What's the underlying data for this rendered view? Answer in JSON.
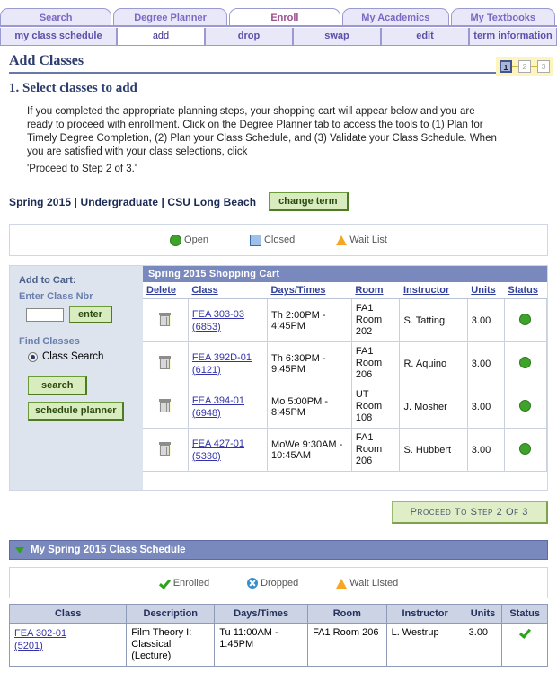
{
  "main_tabs": [
    {
      "label": "Search",
      "active": false
    },
    {
      "label": "Degree Planner",
      "active": false
    },
    {
      "label": "Enroll",
      "active": true
    },
    {
      "label": "My Academics",
      "active": false
    },
    {
      "label": "My Textbooks",
      "active": false
    }
  ],
  "sub_tabs": [
    {
      "label": "my class schedule",
      "active": false
    },
    {
      "label": "add",
      "active": true
    },
    {
      "label": "drop",
      "active": false
    },
    {
      "label": "swap",
      "active": false
    },
    {
      "label": "edit",
      "active": false
    },
    {
      "label": "term information",
      "active": false
    }
  ],
  "page": {
    "title": "Add Classes",
    "section_heading": "1.  Select classes to add",
    "instructions": "If you completed the appropriate planning steps, your shopping cart will appear below and you are ready to proceed with enrollment. Click on the Degree Planner tab to access the tools to (1) Plan for Timely Degree Completion, (2) Plan your Class Schedule, and (3) Validate your Class Schedule. When you are satisfied with your class selections, click",
    "instructions_last_line": "'Proceed to Step 2 of 3.'"
  },
  "steps": [
    {
      "label": "1",
      "current": true
    },
    {
      "label": "2",
      "current": false
    },
    {
      "label": "3",
      "current": false
    }
  ],
  "term": {
    "text": "Spring 2015 | Undergraduate | CSU Long Beach",
    "change_button": "change term"
  },
  "legend_cart": [
    {
      "icon": "green-circle-icon",
      "label": "Open"
    },
    {
      "icon": "blue-square-icon",
      "label": "Closed"
    },
    {
      "icon": "yellow-triangle-icon",
      "label": "Wait List"
    }
  ],
  "sidebar": {
    "add_to_cart_label": "Add to Cart:",
    "enter_class_nbr_label": "Enter Class Nbr",
    "class_nbr_value": "",
    "enter_button": "enter",
    "find_classes_label": "Find Classes",
    "class_search_label": "Class Search",
    "search_button": "search",
    "schedule_planner_button": "schedule planner"
  },
  "cart": {
    "title": "Spring 2015 Shopping Cart",
    "columns": [
      "Delete",
      "Class",
      "Days/Times",
      "Room",
      "Instructor",
      "Units",
      "Status"
    ],
    "rows": [
      {
        "delete_icon": "trash-icon",
        "class_code": "FEA 303-03",
        "class_nbr": "(6853)",
        "days_times": "Th 2:00PM - 4:45PM",
        "room": "FA1 Room 202",
        "instructor": "S. Tatting",
        "units": "3.00",
        "status": "open"
      },
      {
        "delete_icon": "trash-icon",
        "class_code": "FEA 392D-01",
        "class_nbr": "(6121)",
        "days_times": "Th 6:30PM - 9:45PM",
        "room": "FA1 Room 206",
        "instructor": "R. Aquino",
        "units": "3.00",
        "status": "open"
      },
      {
        "delete_icon": "trash-icon",
        "class_code": "FEA 394-01",
        "class_nbr": "(6948)",
        "days_times": "Mo 5:00PM - 8:45PM",
        "room": "UT Room 108",
        "instructor": "J. Mosher",
        "units": "3.00",
        "status": "open"
      },
      {
        "delete_icon": "trash-icon",
        "class_code": "FEA 427-01",
        "class_nbr": "(5330)",
        "days_times": "MoWe 9:30AM - 10:45AM",
        "room": "FA1 Room 206",
        "instructor": "S. Hubbert",
        "units": "3.00",
        "status": "open"
      }
    ]
  },
  "proceed_button": "Proceed To Step 2 Of 3",
  "schedule": {
    "header": "My Spring 2015 Class Schedule",
    "legend": [
      {
        "icon": "green-check-icon",
        "label": "Enrolled"
      },
      {
        "icon": "blue-x-circle-icon",
        "label": "Dropped"
      },
      {
        "icon": "yellow-triangle-icon",
        "label": "Wait Listed"
      }
    ],
    "columns": [
      "Class",
      "Description",
      "Days/Times",
      "Room",
      "Instructor",
      "Units",
      "Status"
    ],
    "rows": [
      {
        "class_code": "FEA 302-01",
        "class_nbr": "(5201)",
        "description": "Film Theory I: Classical (Lecture)",
        "days_times": "Tu 11:00AM - 1:45PM",
        "room": "FA1  Room 206",
        "instructor": "L. Westrup",
        "units": "3.00",
        "status": "enrolled"
      }
    ]
  },
  "colors": {
    "tab_border": "#9a9ad0",
    "tab_text": "#7b68c4",
    "active_tab_text": "#9b4f8e",
    "cart_header_bg": "#7a89bd",
    "sidebar_bg": "#dde4ee",
    "green_button": "#d9ecc0",
    "link": "#3333aa",
    "open_status": "#3fa22a",
    "title_text": "#2d3e6e"
  }
}
